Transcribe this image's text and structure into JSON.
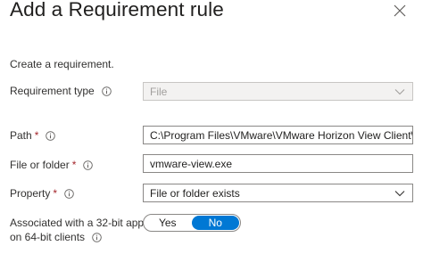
{
  "dialog": {
    "title": "Add a Requirement rule",
    "intro": "Create a requirement."
  },
  "fields": {
    "requirement_type": {
      "label": "Requirement type",
      "value": "File",
      "disabled": true
    },
    "path": {
      "label": "Path",
      "required": "*",
      "value": "C:\\Program Files\\VMware\\VMware Horizon View Client\\"
    },
    "file_or_folder": {
      "label": "File or folder",
      "required": "*",
      "value": "vmware-view.exe"
    },
    "property": {
      "label": "Property",
      "required": "*",
      "value": "File or folder exists"
    },
    "associated_32bit": {
      "label_line1": "Associated with a 32-bit app",
      "label_line2": "on 64-bit clients",
      "options": [
        "Yes",
        "No"
      ],
      "selected": "No"
    }
  },
  "colors": {
    "accent": "#0078d4",
    "required": "#a4262c",
    "border": "#8a8886",
    "disabled_bg": "#f3f2f1"
  },
  "icons": [
    "close-icon",
    "info-icon",
    "chevron-down-icon"
  ]
}
